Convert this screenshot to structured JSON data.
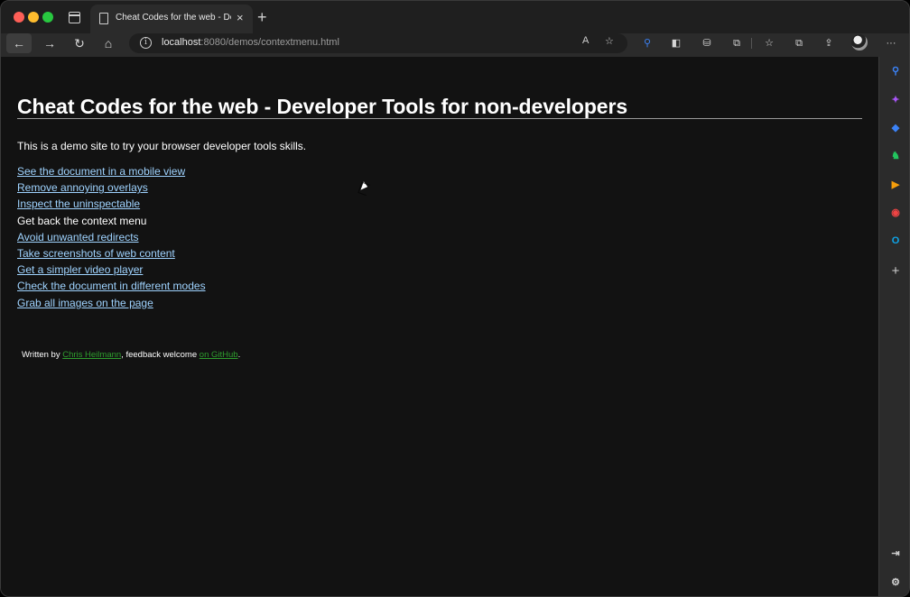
{
  "browser": {
    "tab_title": "Cheat Codes for the web - Developer Tools for non-developers",
    "tab_close": "×",
    "new_tab": "+",
    "url_host": "localhost",
    "url_rest": ":8080/demos/contextmenu.html",
    "back_glyph": "←",
    "forward_glyph": "→",
    "reload_glyph": "↻",
    "home_glyph": "⌂",
    "info_glyph": "i",
    "read_aloud_glyph": "A",
    "favorite_glyph": "☆",
    "more_glyph": "···",
    "extension_glyphs": [
      "⚲",
      "◧",
      "⛁",
      "⧉",
      "☆",
      "⧉",
      "⇪"
    ]
  },
  "page": {
    "heading": "Cheat Codes for the web - Developer Tools for non-developers",
    "intro": "This is a demo site to try your browser developer tools skills.",
    "links": [
      {
        "label": "See the document in a mobile view",
        "link": true
      },
      {
        "label": "Remove annoying overlays",
        "link": true
      },
      {
        "label": "Inspect the uninspectable",
        "link": true
      },
      {
        "label": "Get back the context menu",
        "link": false
      },
      {
        "label": "Avoid unwanted redirects",
        "link": true
      },
      {
        "label": "Take screenshots of web content",
        "link": true
      },
      {
        "label": "Get a simpler video player",
        "link": true
      },
      {
        "label": "Check the document in different modes",
        "link": true
      },
      {
        "label": "Grab all images on the page",
        "link": true
      }
    ],
    "footer": {
      "prefix": "Written by ",
      "author": "Chris Heilmann",
      "middle": ", feedback welcome ",
      "github": "on GitHub",
      "suffix": "."
    }
  },
  "sidebar": {
    "icons": [
      {
        "name": "search-sidebar-icon",
        "glyph": "⚲",
        "color": "#3b82f6"
      },
      {
        "name": "copilot-sidebar-icon",
        "glyph": "✦",
        "color": "#a855f7"
      },
      {
        "name": "shopping-sidebar-icon",
        "glyph": "◆",
        "color": "#3b82f6"
      },
      {
        "name": "games-sidebar-icon",
        "glyph": "♞",
        "color": "#22c55e"
      },
      {
        "name": "tools-sidebar-icon",
        "glyph": "▶",
        "color": "#f59e0b"
      },
      {
        "name": "office-sidebar-icon",
        "glyph": "◉",
        "color": "#ef4444"
      },
      {
        "name": "outlook-sidebar-icon",
        "glyph": "O",
        "color": "#0ea5e9"
      },
      {
        "name": "add-sidebar-icon",
        "glyph": "+",
        "color": "#cfcfcf"
      },
      {
        "name": "hide-sidebar-icon",
        "glyph": "⇥",
        "color": "#cfcfcf"
      },
      {
        "name": "settings-sidebar-icon",
        "glyph": "⚙",
        "color": "#cfcfcf"
      }
    ]
  }
}
